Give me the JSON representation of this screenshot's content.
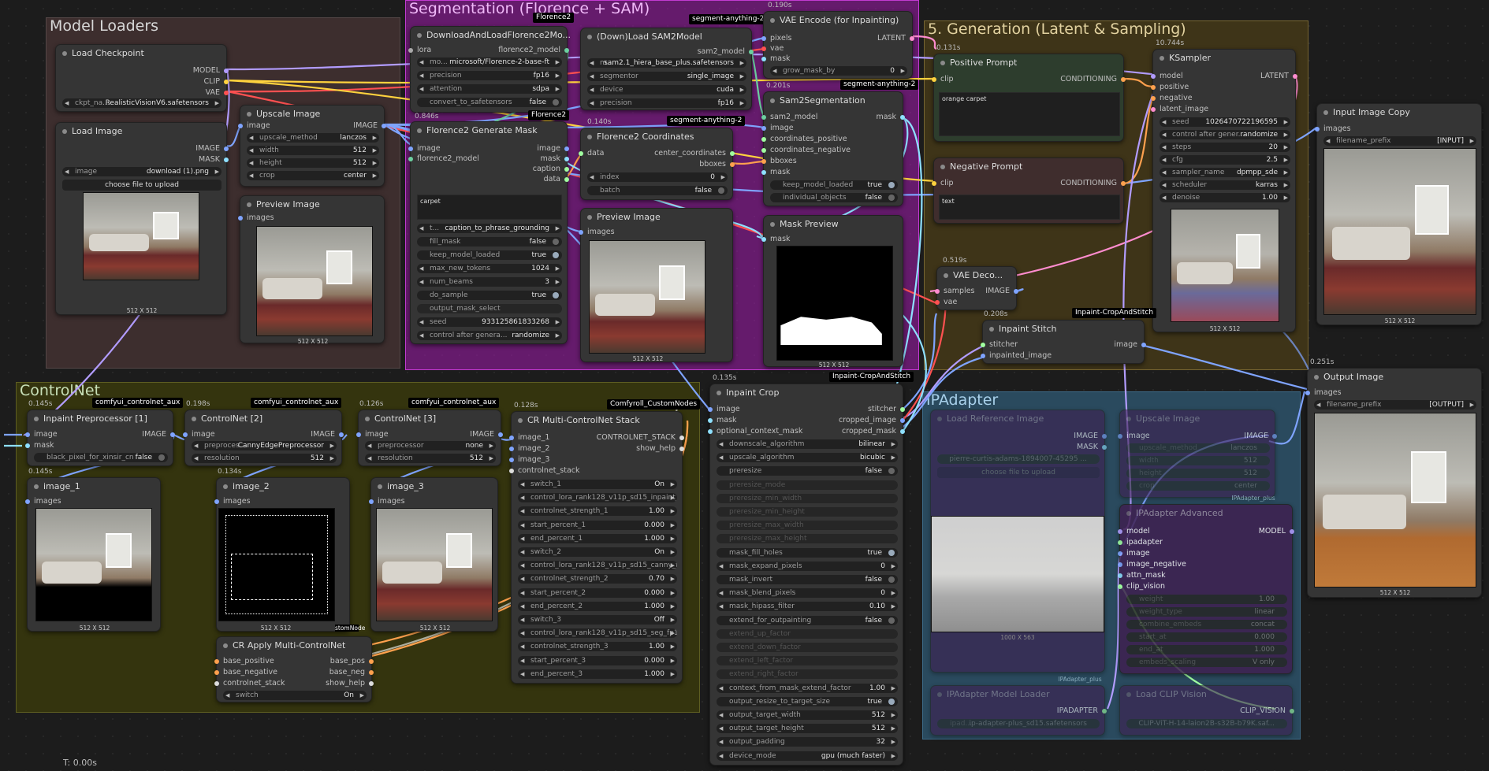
{
  "groups": {
    "model_loaders": "Model Loaders",
    "segmentation": "Segmentation (Florence + SAM)",
    "generation": "5. Generation (Latent & Sampling)",
    "controlnet": "ControlNet",
    "ipadapter": "IPAdapter"
  },
  "colors": {
    "segmentation_group": "#a21caf",
    "generation_group": "#5b4a14",
    "controlnet_group": "#3d3d10",
    "ipadapter_group": "#2a4a5e",
    "model_loaders_group": "#3d2e2e"
  },
  "footer": {
    "time": "T: 0.00s"
  },
  "load_checkpoint": {
    "title": "Load Checkpoint",
    "out_model": "MODEL",
    "out_clip": "CLIP",
    "out_vae": "VAE",
    "ckpt_label": "ckpt_na...",
    "ckpt_value": "RealisticVisionV6.safetensors"
  },
  "load_image": {
    "title": "Load Image",
    "out_image": "IMAGE",
    "out_mask": "MASK",
    "image_label": "image",
    "image_value": "download (1).png",
    "upload": "choose file to upload",
    "size": "512 X 512"
  },
  "upscale_image": {
    "title": "Upscale Image",
    "in_image": "image",
    "out_image": "IMAGE",
    "method_label": "upscale_method",
    "method_value": "lanczos",
    "width_label": "width",
    "width_value": "512",
    "height_label": "height",
    "height_value": "512",
    "crop_label": "crop",
    "crop_value": "center"
  },
  "preview_image_1": {
    "title": "Preview Image",
    "in_images": "images",
    "size": "512 X 512"
  },
  "florence_loader": {
    "title": "DownloadAndLoadFlorence2Mo...",
    "badge": "Florence2",
    "in_lora": "lora",
    "out_model": "florence2_model",
    "model_label": "mo...",
    "model_value": "microsoft/Florence-2-base-ft",
    "precision_label": "precision",
    "precision_value": "fp16",
    "attention_label": "attention",
    "attention_value": "sdpa",
    "convert_label": "convert_to_safetensors",
    "convert_value": "false"
  },
  "florence_mask": {
    "time": "0.846s",
    "badge": "Florence2",
    "title": "Florence2 Generate Mask",
    "in_image": "image",
    "in_model": "florence2_model",
    "out_image": "image",
    "out_mask": "mask",
    "out_caption": "caption",
    "out_data": "data",
    "text": "carpet",
    "task_label": "t...",
    "task_value": "caption_to_phrase_grounding",
    "fill_label": "fill_mask",
    "fill_value": "false",
    "keep_label": "keep_model_loaded",
    "keep_value": "true",
    "tokens_label": "max_new_tokens",
    "tokens_value": "1024",
    "beams_label": "num_beams",
    "beams_value": "3",
    "sample_label": "do_sample",
    "sample_value": "true",
    "output_select": "output_mask_select",
    "seed_label": "seed",
    "seed_value": "933125861833268",
    "control_label": "control after genera...",
    "control_value": "randomize"
  },
  "sam2_loader": {
    "title": "(Down)Load SAM2Model",
    "badge": "segment-anything-2",
    "out_model": "sam2_model",
    "model_label": "m...",
    "model_value": "sam2.1_hiera_base_plus.safetensors",
    "segmentor_label": "segmentor",
    "segmentor_value": "single_image",
    "device_label": "device",
    "device_value": "cuda",
    "precision_label": "precision",
    "precision_value": "fp16"
  },
  "florence_coords": {
    "time": "0.140s",
    "badge": "segment-anything-2",
    "title": "Florence2 Coordinates",
    "in_data": "data",
    "out_center": "center_coordinates",
    "out_bboxes": "bboxes",
    "index_label": "index",
    "index_value": "0",
    "batch_label": "batch",
    "batch_value": "false"
  },
  "preview_image_2": {
    "title": "Preview Image",
    "in_images": "images",
    "size": "512 X 512"
  },
  "vae_encode": {
    "time": "0.190s",
    "title": "VAE Encode (for Inpainting)",
    "in_pixels": "pixels",
    "in_vae": "vae",
    "in_mask": "mask",
    "out_latent": "LATENT",
    "grow_label": "grow_mask_by",
    "grow_value": "0"
  },
  "sam2seg": {
    "time": "0.201s",
    "badge": "segment-anything-2",
    "title": "Sam2Segmentation",
    "in_model": "sam2_model",
    "in_image": "image",
    "in_pos": "coordinates_positive",
    "in_neg": "coordinates_negative",
    "in_bboxes": "bboxes",
    "in_mask": "mask",
    "out_mask": "mask",
    "keep_label": "keep_model_loaded",
    "keep_value": "true",
    "objects_label": "individual_objects",
    "objects_value": "false"
  },
  "mask_preview": {
    "title": "Mask Preview",
    "in_mask": "mask",
    "size": "512 X 512"
  },
  "positive_prompt": {
    "time": "0.131s",
    "title": "Positive Prompt",
    "in_clip": "clip",
    "out_cond": "CONDITIONING",
    "text": "orange carpet"
  },
  "negative_prompt": {
    "title": "Negative Prompt",
    "in_clip": "clip",
    "out_cond": "CONDITIONING",
    "text": "text"
  },
  "ksampler": {
    "time": "10.744s",
    "title": "KSampler",
    "in_model": "model",
    "in_pos": "positive",
    "in_neg": "negative",
    "in_latent": "latent_image",
    "out_latent": "LATENT",
    "seed_label": "seed",
    "seed_value": "1026470722196595",
    "control_label": "control after gener...",
    "control_value": "randomize",
    "steps_label": "steps",
    "steps_value": "20",
    "cfg_label": "cfg",
    "cfg_value": "2.5",
    "sampler_label": "sampler_name",
    "sampler_value": "dpmpp_sde",
    "scheduler_label": "scheduler",
    "scheduler_value": "karras",
    "denoise_label": "denoise",
    "denoise_value": "1.00",
    "size": "512 X 512"
  },
  "vae_decode": {
    "time": "0.519s",
    "title": "VAE Deco...",
    "in_samples": "samples",
    "in_vae": "vae",
    "out_image": "IMAGE"
  },
  "inpaint_stitch": {
    "time": "0.208s",
    "badge": "Inpaint-CropAndStitch",
    "title": "Inpaint Stitch",
    "in_stitcher": "stitcher",
    "in_image": "inpainted_image",
    "out_image": "image"
  },
  "input_image_copy": {
    "title": "Input Image Copy",
    "in_images": "images",
    "prefix_label": "filename_prefix",
    "prefix_value": "[INPUT]",
    "size": "512 X 512"
  },
  "output_image": {
    "time": "0.251s",
    "title": "Output Image",
    "in_images": "images",
    "prefix_label": "filename_prefix",
    "prefix_value": "[OUTPUT]",
    "size": "512 X 512"
  },
  "inpaint_pre": {
    "time": "0.145s",
    "badge": "comfyui_controlnet_aux",
    "title": "Inpaint Preprocessor [1]",
    "in_image": "image",
    "in_mask": "mask",
    "out_image": "IMAGE",
    "black_label": "black_pixel_for_xinsir_cn",
    "black_value": "false"
  },
  "controlnet2": {
    "time": "0.198s",
    "badge": "comfyui_controlnet_aux",
    "title": "ControlNet [2]",
    "in_image": "image",
    "out_image": "IMAGE",
    "pre_label": "preproces...",
    "pre_value": "CannyEdgePreprocessor",
    "res_label": "resolution",
    "res_value": "512"
  },
  "controlnet3": {
    "time": "0.126s",
    "badge": "comfyui_controlnet_aux",
    "title": "ControlNet [3]",
    "in_image": "image",
    "out_image": "IMAGE",
    "pre_label": "preprocessor",
    "pre_value": "none",
    "res_label": "resolution",
    "res_value": "512"
  },
  "cr_stack": {
    "time": "0.128s",
    "badge": "Comfyroll_CustomNodes",
    "title": "CR Multi-ControlNet Stack",
    "in_i1": "image_1",
    "in_i2": "image_2",
    "in_i3": "image_3",
    "in_stack": "controlnet_stack",
    "out_stack": "CONTROLNET_STACK",
    "out_help": "show_help",
    "rows": [
      {
        "l": "switch_1",
        "v": "On"
      },
      {
        "l": "control_lora_rank128_v11p_sd15_inpaint_...",
        "v": ""
      },
      {
        "l": "controlnet_strength_1",
        "v": "1.00"
      },
      {
        "l": "start_percent_1",
        "v": "0.000"
      },
      {
        "l": "end_percent_1",
        "v": "1.000"
      },
      {
        "l": "switch_2",
        "v": "On"
      },
      {
        "l": "control_lora_rank128_v11p_sd15_canny_f...",
        "v": ""
      },
      {
        "l": "controlnet_strength_2",
        "v": "0.70"
      },
      {
        "l": "start_percent_2",
        "v": "0.000"
      },
      {
        "l": "end_percent_2",
        "v": "1.000"
      },
      {
        "l": "switch_3",
        "v": "Off"
      },
      {
        "l": "control_lora_rank128_v11p_sd15_seg_fp1...",
        "v": ""
      },
      {
        "l": "controlnet_strength_3",
        "v": "1.00"
      },
      {
        "l": "start_percent_3",
        "v": "0.000"
      },
      {
        "l": "end_percent_3",
        "v": "1.000"
      }
    ]
  },
  "image_1": {
    "time": "0.145s",
    "title": "image_1",
    "in_images": "images",
    "size": "512 X 512"
  },
  "image_2": {
    "time": "0.134s",
    "title": "image_2",
    "in_images": "images",
    "size": "512 X 512",
    "partial": "stomNode"
  },
  "image_3": {
    "title": "image_3",
    "in_images": "images",
    "size": "512 X 512"
  },
  "cr_apply": {
    "title": "CR Apply Multi-ControlNet",
    "in_pos": "base_positive",
    "in_neg": "base_negative",
    "in_stack": "controlnet_stack",
    "out_pos": "base_pos",
    "out_neg": "base_neg",
    "out_help": "show_help",
    "switch_label": "switch",
    "switch_value": "On"
  },
  "inpaint_crop": {
    "time": "0.135s",
    "badge": "Inpaint-CropAndStitch",
    "title": "Inpaint Crop",
    "in_image": "image",
    "in_mask": "mask",
    "in_ctx": "optional_context_mask",
    "out_stitcher": "stitcher",
    "out_image": "cropped_image",
    "out_mask": "cropped_mask",
    "rows": [
      {
        "l": "downscale_algorithm",
        "v": "bilinear",
        "t": "w"
      },
      {
        "l": "upscale_algorithm",
        "v": "bicubic",
        "t": "w"
      },
      {
        "l": "preresize",
        "v": "false",
        "t": "tog"
      },
      {
        "l": "preresize_mode",
        "v": "",
        "t": "dis"
      },
      {
        "l": "preresize_min_width",
        "v": "",
        "t": "dis"
      },
      {
        "l": "preresize_min_height",
        "v": "",
        "t": "dis"
      },
      {
        "l": "preresize_max_width",
        "v": "",
        "t": "dis"
      },
      {
        "l": "preresize_max_height",
        "v": "",
        "t": "dis"
      },
      {
        "l": "mask_fill_holes",
        "v": "true",
        "t": "togon"
      },
      {
        "l": "mask_expand_pixels",
        "v": "0",
        "t": "w"
      },
      {
        "l": "mask_invert",
        "v": "false",
        "t": "tog"
      },
      {
        "l": "mask_blend_pixels",
        "v": "0",
        "t": "w"
      },
      {
        "l": "mask_hipass_filter",
        "v": "0.10",
        "t": "w"
      },
      {
        "l": "extend_for_outpainting",
        "v": "false",
        "t": "tog"
      },
      {
        "l": "extend_up_factor",
        "v": "",
        "t": "dis"
      },
      {
        "l": "extend_down_factor",
        "v": "",
        "t": "dis"
      },
      {
        "l": "extend_left_factor",
        "v": "",
        "t": "dis"
      },
      {
        "l": "extend_right_factor",
        "v": "",
        "t": "dis"
      },
      {
        "l": "context_from_mask_extend_factor",
        "v": "1.00",
        "t": "w"
      },
      {
        "l": "output_resize_to_target_size",
        "v": "true",
        "t": "togon"
      },
      {
        "l": "output_target_width",
        "v": "512",
        "t": "w"
      },
      {
        "l": "output_target_height",
        "v": "512",
        "t": "w"
      },
      {
        "l": "output_padding",
        "v": "32",
        "t": "w"
      },
      {
        "l": "device_mode",
        "v": "gpu (much faster)",
        "t": "w"
      }
    ]
  },
  "load_ref": {
    "title": "Load Reference Image",
    "out_image": "IMAGE",
    "out_mask": "MASK",
    "image_value": "pierre-curtis-adams-1894007-45295 ...",
    "upload": "choose file to upload",
    "size": "1000 X 563"
  },
  "upscale_ref": {
    "title": "Upscale Image",
    "in_image": "image",
    "out_image": "IMAGE",
    "method_label": "upscale_method",
    "method_value": "lanczos",
    "width_label": "width",
    "width_value": "512",
    "height_label": "height",
    "height_value": "512",
    "crop_label": "crop",
    "crop_value": "center",
    "badge": "IPAdapter_plus"
  },
  "ipadapter_adv": {
    "title": "IPAdapter Advanced",
    "in_model": "model",
    "in_ipadapter": "ipadapter",
    "in_image": "image",
    "in_neg": "image_negative",
    "in_attn": "attn_mask",
    "in_clip": "clip_vision",
    "out_model": "MODEL",
    "weight_label": "weight",
    "weight_value": "1.00",
    "wtype_label": "weight_type",
    "wtype_value": "linear",
    "combine_label": "combine_embeds",
    "combine_value": "concat",
    "start_label": "start_at",
    "start_value": "0.000",
    "end_label": "end_at",
    "end_value": "1.000",
    "scaling_label": "embeds_scaling",
    "scaling_value": "V only"
  },
  "ipadapter_loader": {
    "badge": "IPAdapter_plus",
    "title": "IPAdapter Model Loader",
    "out": "IPADAPTER",
    "value": "ip-adapter-plus_sd15.safetensors",
    "label": "ipad..."
  },
  "clip_loader": {
    "title": "Load CLIP Vision",
    "out": "CLIP_VISION",
    "value": "CLIP-ViT-H-14-laion2B-s32B-b79K.saf..."
  }
}
